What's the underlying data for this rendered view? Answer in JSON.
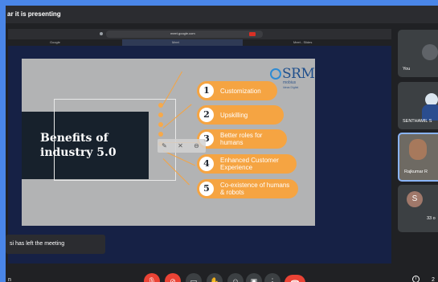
{
  "window": {
    "title": "ar it is presenting"
  },
  "browser": {
    "address_text": "meet.google.com",
    "left_tab_text": "Google",
    "active_tab_text": "Meet",
    "right_tab_text": "Meet - Slides"
  },
  "slide": {
    "title": "Benefits of industry 5.0",
    "logo_text": "SRM",
    "logo_sub_1": "mobius",
    "logo_sub_2": "Ideas Digital",
    "items": [
      {
        "num": "1",
        "label": "Customization"
      },
      {
        "num": "2",
        "label": "Upskilling"
      },
      {
        "num": "3",
        "label": "Better roles for humans"
      },
      {
        "num": "4",
        "label": "Enhanced Customer Experience"
      },
      {
        "num": "5",
        "label": "Co-existence of humans & robots"
      }
    ]
  },
  "participants": [
    {
      "name": "You",
      "kind": "video"
    },
    {
      "name": "SENTHAMIL S",
      "kind": "video"
    },
    {
      "name": "Rajkumar R",
      "kind": "video",
      "active": true
    },
    {
      "name": "33 o",
      "kind": "initial",
      "initial": "S"
    }
  ],
  "notification": {
    "text": "si has left the meeting"
  },
  "bottom": {
    "left_text": "n",
    "right_text": "2"
  },
  "colors": {
    "accent": "#4a86e8",
    "stage_bg": "#162145",
    "pill": "#f5a442",
    "slide_dark": "#17212c",
    "end_call": "#ea4335"
  }
}
